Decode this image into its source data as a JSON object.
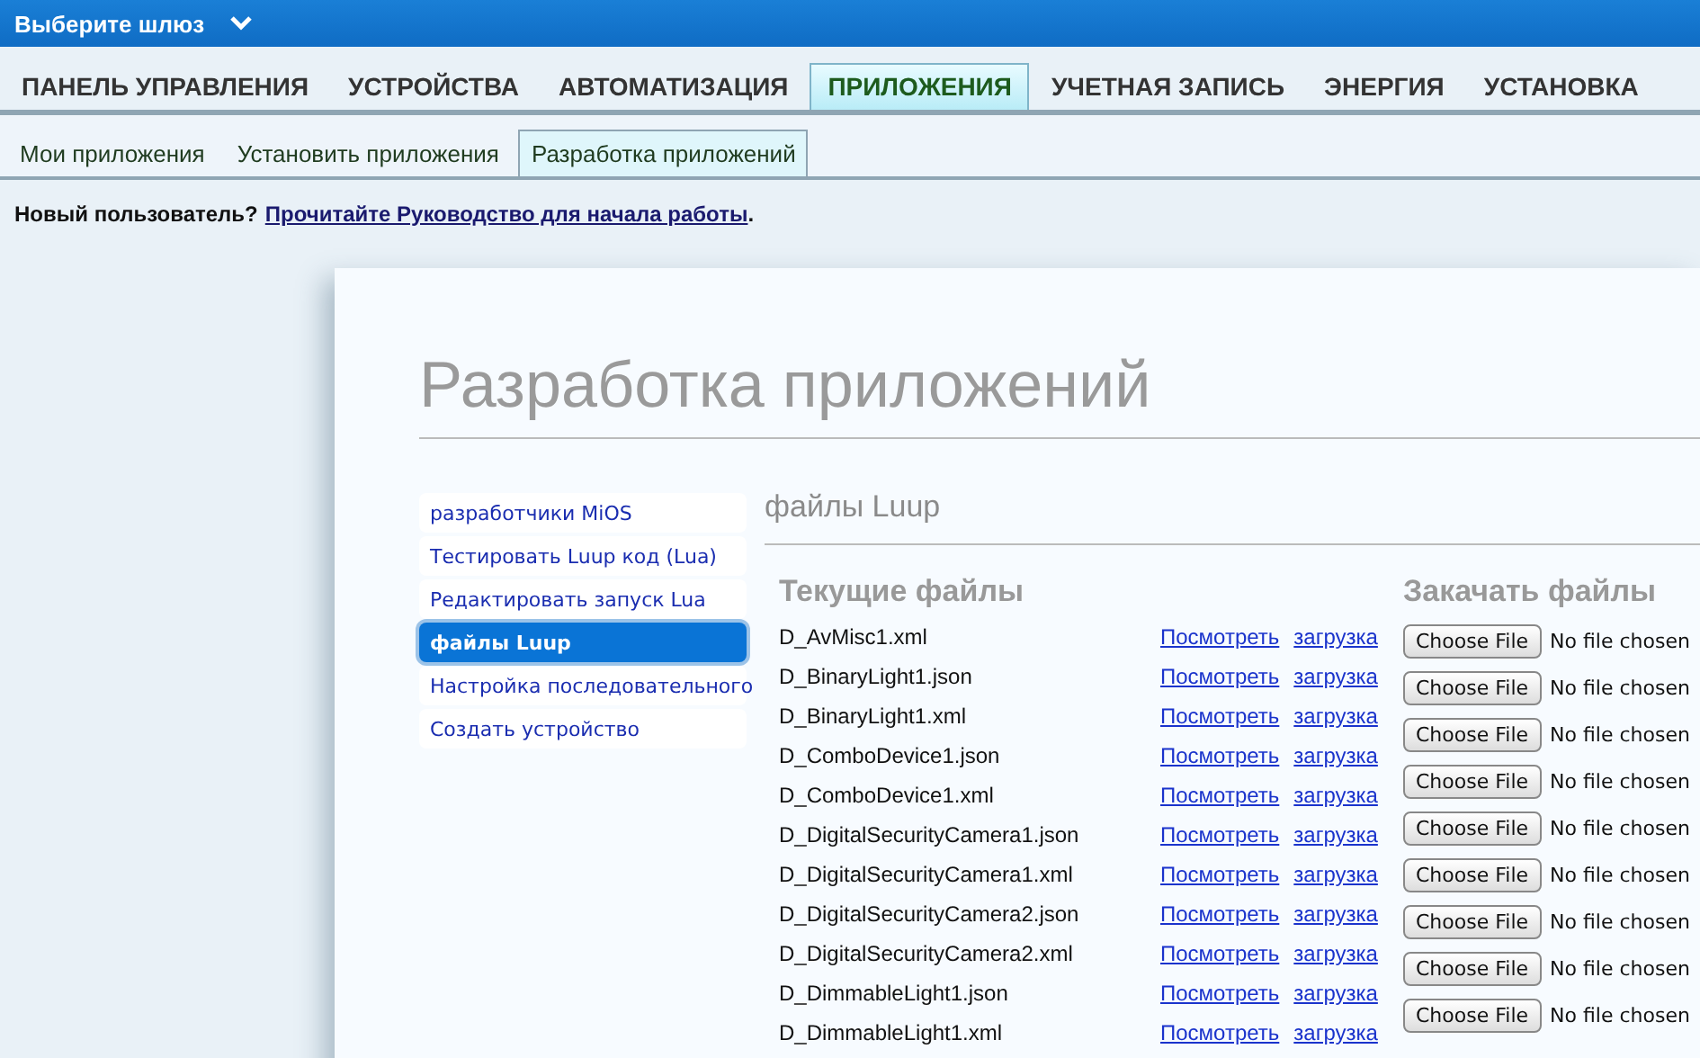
{
  "topbar": {
    "gateway_label": "Выберите шлюз"
  },
  "main_tabs": [
    {
      "label": "ПАНЕЛЬ УПРАВЛЕНИЯ",
      "selected": false
    },
    {
      "label": "УСТРОЙСТВА",
      "selected": false
    },
    {
      "label": "АВТОМАТИЗАЦИЯ",
      "selected": false
    },
    {
      "label": "ПРИЛОЖЕНИЯ",
      "selected": true
    },
    {
      "label": "УЧЕТНАЯ ЗАПИСЬ",
      "selected": false
    },
    {
      "label": "ЭНЕРГИЯ",
      "selected": false
    },
    {
      "label": "УСТАНОВКА",
      "selected": false
    }
  ],
  "sub_tabs": [
    {
      "label": "Мои приложения",
      "selected": false
    },
    {
      "label": "Установить приложения",
      "selected": false
    },
    {
      "label": "Разработка приложений",
      "selected": true
    }
  ],
  "notice": {
    "text": "Новый пользователь?",
    "link": "Прочитайте Руководство для начала работы",
    "suffix": "."
  },
  "page_title": "Разработка приложений",
  "sidebar": {
    "items": [
      {
        "label": "разработчики MiOS",
        "selected": false
      },
      {
        "label": "Тестировать Luup код (Lua)",
        "selected": false
      },
      {
        "label": "Редактировать запуск Lua",
        "selected": false
      },
      {
        "label": "файлы Luup",
        "selected": true
      },
      {
        "label": "Настройка последовательного",
        "selected": false
      },
      {
        "label": "Создать устройство",
        "selected": false
      }
    ]
  },
  "section_title": "файлы Luup",
  "current_files": {
    "heading": "Текущие файлы",
    "rows": [
      {
        "name": "D_AvMisc1.xml",
        "view": "Посмотреть",
        "download": "загрузка"
      },
      {
        "name": "D_BinaryLight1.json",
        "view": "Посмотреть",
        "download": "загрузка"
      },
      {
        "name": "D_BinaryLight1.xml",
        "view": "Посмотреть",
        "download": "загрузка"
      },
      {
        "name": "D_ComboDevice1.json",
        "view": "Посмотреть",
        "download": "загрузка"
      },
      {
        "name": "D_ComboDevice1.xml",
        "view": "Посмотреть",
        "download": "загрузка"
      },
      {
        "name": "D_DigitalSecurityCamera1.json",
        "view": "Посмотреть",
        "download": "загрузка"
      },
      {
        "name": "D_DigitalSecurityCamera1.xml",
        "view": "Посмотреть",
        "download": "загрузка"
      },
      {
        "name": "D_DigitalSecurityCamera2.json",
        "view": "Посмотреть",
        "download": "загрузка"
      },
      {
        "name": "D_DigitalSecurityCamera2.xml",
        "view": "Посмотреть",
        "download": "загрузка"
      },
      {
        "name": "D_DimmableLight1.json",
        "view": "Посмотреть",
        "download": "загрузка"
      },
      {
        "name": "D_DimmableLight1.xml",
        "view": "Посмотреть",
        "download": "загрузка"
      }
    ]
  },
  "upload": {
    "heading": "Закачать файлы",
    "rows": [
      {
        "button": "Choose File",
        "status": "No file chosen"
      },
      {
        "button": "Choose File",
        "status": "No file chosen"
      },
      {
        "button": "Choose File",
        "status": "No file chosen"
      },
      {
        "button": "Choose File",
        "status": "No file chosen"
      },
      {
        "button": "Choose File",
        "status": "No file chosen"
      },
      {
        "button": "Choose File",
        "status": "No file chosen"
      },
      {
        "button": "Choose File",
        "status": "No file chosen"
      },
      {
        "button": "Choose File",
        "status": "No file chosen"
      },
      {
        "button": "Choose File",
        "status": "No file chosen"
      }
    ]
  }
}
